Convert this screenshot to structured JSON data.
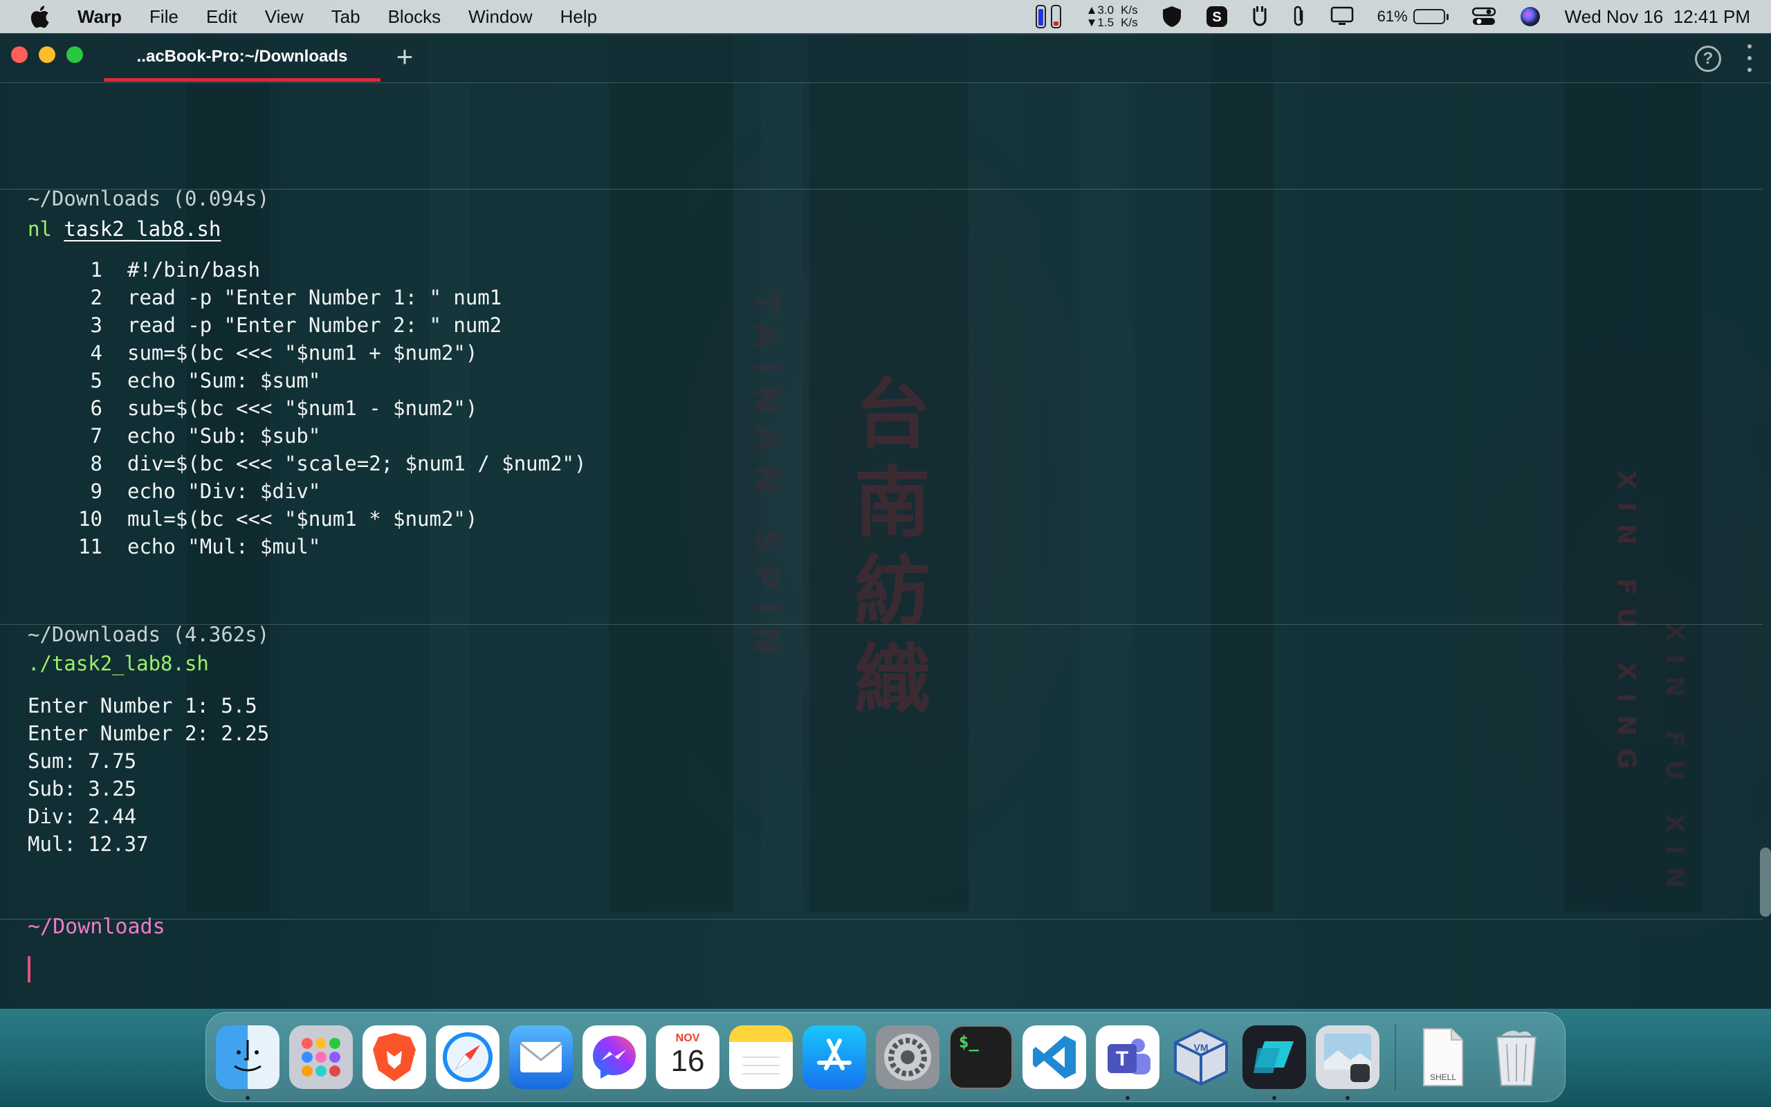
{
  "menubar": {
    "app_name": "Warp",
    "menus": [
      "File",
      "Edit",
      "View",
      "Tab",
      "Blocks",
      "Window",
      "Help"
    ],
    "net_up": "▲3.0",
    "net_down": "▼1.5",
    "net_unit_up": "K/s",
    "net_unit_down": "K/s",
    "battery_percent": "61%",
    "battery_level": 0.61,
    "datetime": "Wed Nov 16  12:41 PM"
  },
  "window": {
    "tab_title": "..acBook-Pro:~/Downloads",
    "new_tab_label": "+",
    "help_label": "?"
  },
  "blocks": [
    {
      "header": "~/Downloads (0.094s)",
      "command_prog": "nl",
      "command_arg": "task2_lab8.sh",
      "lines": [
        {
          "n": "1",
          "text": "#!/bin/bash"
        },
        {
          "n": "2",
          "text": "read -p \"Enter Number 1: \" num1"
        },
        {
          "n": "3",
          "text": "read -p \"Enter Number 2: \" num2"
        },
        {
          "n": "4",
          "text": "sum=$(bc <<< \"$num1 + $num2\")"
        },
        {
          "n": "5",
          "text": "echo \"Sum: $sum\""
        },
        {
          "n": "6",
          "text": "sub=$(bc <<< \"$num1 - $num2\")"
        },
        {
          "n": "7",
          "text": "echo \"Sub: $sub\""
        },
        {
          "n": "8",
          "text": "div=$(bc <<< \"scale=2; $num1 / $num2\")"
        },
        {
          "n": "9",
          "text": "echo \"Div: $div\""
        },
        {
          "n": "10",
          "text": "mul=$(bc <<< \"$num1 * $num2\")"
        },
        {
          "n": "11",
          "text": "echo \"Mul: $mul\""
        }
      ]
    },
    {
      "header": "~/Downloads (4.362s)",
      "command_full": "./task2_lab8.sh",
      "output": [
        "Enter Number 1: 5.5",
        "Enter Number 2: 2.25",
        "Sum: 7.75",
        "Sub: 3.25",
        "Div: 2.44",
        "Mul: 12.37"
      ]
    }
  ],
  "prompt": {
    "directory": "~/Downloads"
  },
  "dock": {
    "calendar_month": "NOV",
    "calendar_day": "16",
    "terminal_glyph": "$_",
    "shell_doc_label": "SHELL"
  },
  "colors": {
    "accent_tab": "#e0283c",
    "command_green": "#9cf06a",
    "prompt_pink": "#f07cc6"
  }
}
